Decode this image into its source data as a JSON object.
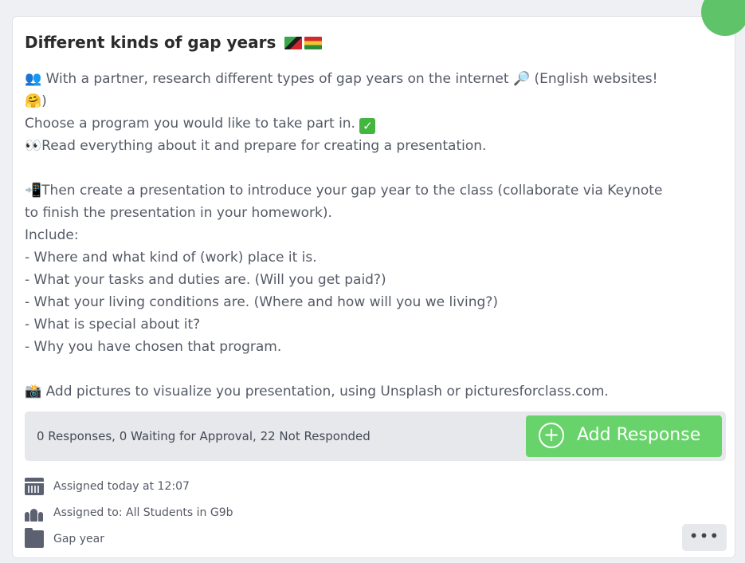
{
  "card": {
    "title": "Different kinds of gap years",
    "lines": [
      "👥 With a partner, research different types of gap years on the internet 🔎 (English websites!",
      "🤗)",
      "Choose a program you would like to take part in.",
      "👀Read everything about it and prepare for creating a presentation.",
      "",
      "📲Then create a presentation to introduce your gap year to the class (collaborate via Keynote",
      "to finish the presentation in your homework).",
      "Include:",
      "- Where and what kind of (work) place it is.",
      "- What your tasks and duties are. (Will you get paid?)",
      "- What your living conditions are. (Where and how will you we living?)",
      "- What is special about it?",
      "- Why you have chosen that program.",
      "",
      "📸 Add pictures to visualize you presentation, using Unsplash or picturesforclass.com."
    ],
    "check_mark": "✓"
  },
  "status": {
    "summary": "0 Responses, 0 Waiting for Approval, 22 Not Responded",
    "add_button_label": "Add Response",
    "add_button_icon": "+"
  },
  "meta": {
    "assigned_time": "Assigned today at 12:07",
    "assigned_to": "Assigned to: All Students in G9b",
    "folder": "Gap year"
  },
  "more_button": "•••",
  "colors": {
    "accent_green": "#68d36a",
    "status_bg": "#e6e8ec",
    "text": "#555a66"
  }
}
